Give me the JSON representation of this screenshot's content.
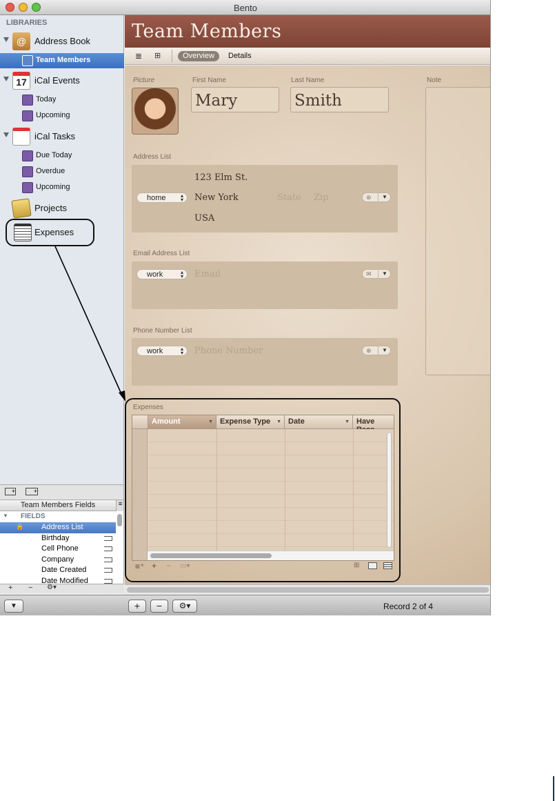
{
  "window": {
    "title": "Bento"
  },
  "sidebar": {
    "header": "LIBRARIES",
    "libraries": [
      {
        "label": "Address Book",
        "icon": "address-book-icon"
      },
      {
        "label": "iCal Events",
        "icon": "calendar-icon",
        "badge": "17"
      },
      {
        "label": "iCal Tasks",
        "icon": "task-list-icon"
      },
      {
        "label": "Projects",
        "icon": "projects-notepad-icon"
      },
      {
        "label": "Expenses",
        "icon": "expenses-calendar-icon"
      }
    ],
    "collections": {
      "address_book": [
        {
          "label": "Team Members",
          "selected": true
        }
      ],
      "ical_events": [
        {
          "label": "Today"
        },
        {
          "label": "Upcoming"
        }
      ],
      "ical_tasks": [
        {
          "label": "Due Today"
        },
        {
          "label": "Overdue"
        },
        {
          "label": "Upcoming"
        }
      ]
    }
  },
  "fields_panel": {
    "title": "Team Members Fields",
    "section": "FIELDS",
    "items": [
      {
        "label": "Address List",
        "selected": true
      },
      {
        "label": "Birthday"
      },
      {
        "label": "Cell Phone"
      },
      {
        "label": "Company"
      },
      {
        "label": "Date Created"
      },
      {
        "label": "Date Modified"
      }
    ],
    "bottom_buttons": {
      "add": "+",
      "remove": "−",
      "gear": "⚙▾"
    }
  },
  "main": {
    "title": "Team Members",
    "view_tabs": {
      "overview": "Overview",
      "details": "Details",
      "active": "Overview"
    },
    "form": {
      "picture_label": "Picture",
      "first_name_label": "First Name",
      "first_name": "Mary",
      "last_name_label": "Last Name",
      "last_name": "Smith",
      "note_label": "Note",
      "address": {
        "label": "Address List",
        "type": "home",
        "street": "123 Elm St.",
        "city": "New York",
        "state_placeholder": "State",
        "zip_placeholder": "Zip",
        "country": "USA"
      },
      "email": {
        "label": "Email Address List",
        "type": "work",
        "placeholder": "Email"
      },
      "phone": {
        "label": "Phone Number List",
        "type": "work",
        "placeholder": "Phone Number"
      },
      "expenses": {
        "label": "Expenses",
        "columns": [
          "Amount",
          "Expense Type",
          "Date",
          "Have Rece"
        ],
        "row_count": 10
      }
    }
  },
  "bottom_bar": {
    "add": "+",
    "remove": "−",
    "gear": "⚙▾",
    "record_text": "Record 2 of 4"
  },
  "colors": {
    "header": "#8b4d3f",
    "form_bg": "#e0cdb6",
    "selection": "#3d74c4"
  }
}
